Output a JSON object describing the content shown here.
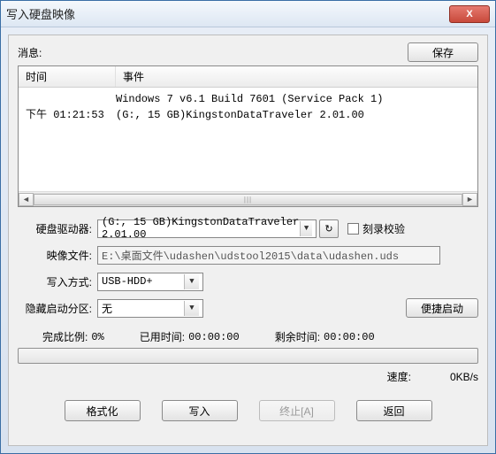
{
  "window": {
    "title": "写入硬盘映像",
    "close": "X"
  },
  "top": {
    "message_label": "消息:",
    "save_button": "保存"
  },
  "log": {
    "headers": {
      "time": "时间",
      "event": "事件"
    },
    "rows": [
      {
        "time": "",
        "event": "Windows 7 v6.1 Build 7601 (Service Pack 1)"
      },
      {
        "time": "下午 01:21:53",
        "event": "(G:, 15 GB)KingstonDataTraveler 2.01.00"
      }
    ],
    "thumb": "|||"
  },
  "form": {
    "drive_label": "硬盘驱动器:",
    "drive_value": "(G:, 15 GB)KingstonDataTraveler 2.01.00",
    "refresh_icon": "↻",
    "verify_label": "刻录校验",
    "file_label": "映像文件:",
    "file_value": "E:\\桌面文件\\udashen\\udstool2015\\data\\udashen.uds",
    "mode_label": "写入方式:",
    "mode_value": "USB-HDD+",
    "hidden_label": "隐藏启动分区:",
    "hidden_value": "无",
    "boot_button": "便捷启动"
  },
  "status": {
    "percent_label": "完成比例:",
    "percent_value": "0%",
    "elapsed_label": "已用时间:",
    "elapsed_value": "00:00:00",
    "remain_label": "剩余时间:",
    "remain_value": "00:00:00",
    "speed_label": "速度:",
    "speed_value": "0KB/s"
  },
  "buttons": {
    "format": "格式化",
    "write": "写入",
    "abort": "终止[A]",
    "back": "返回"
  },
  "arrows": {
    "left": "◄",
    "right": "►",
    "down": "▼"
  }
}
